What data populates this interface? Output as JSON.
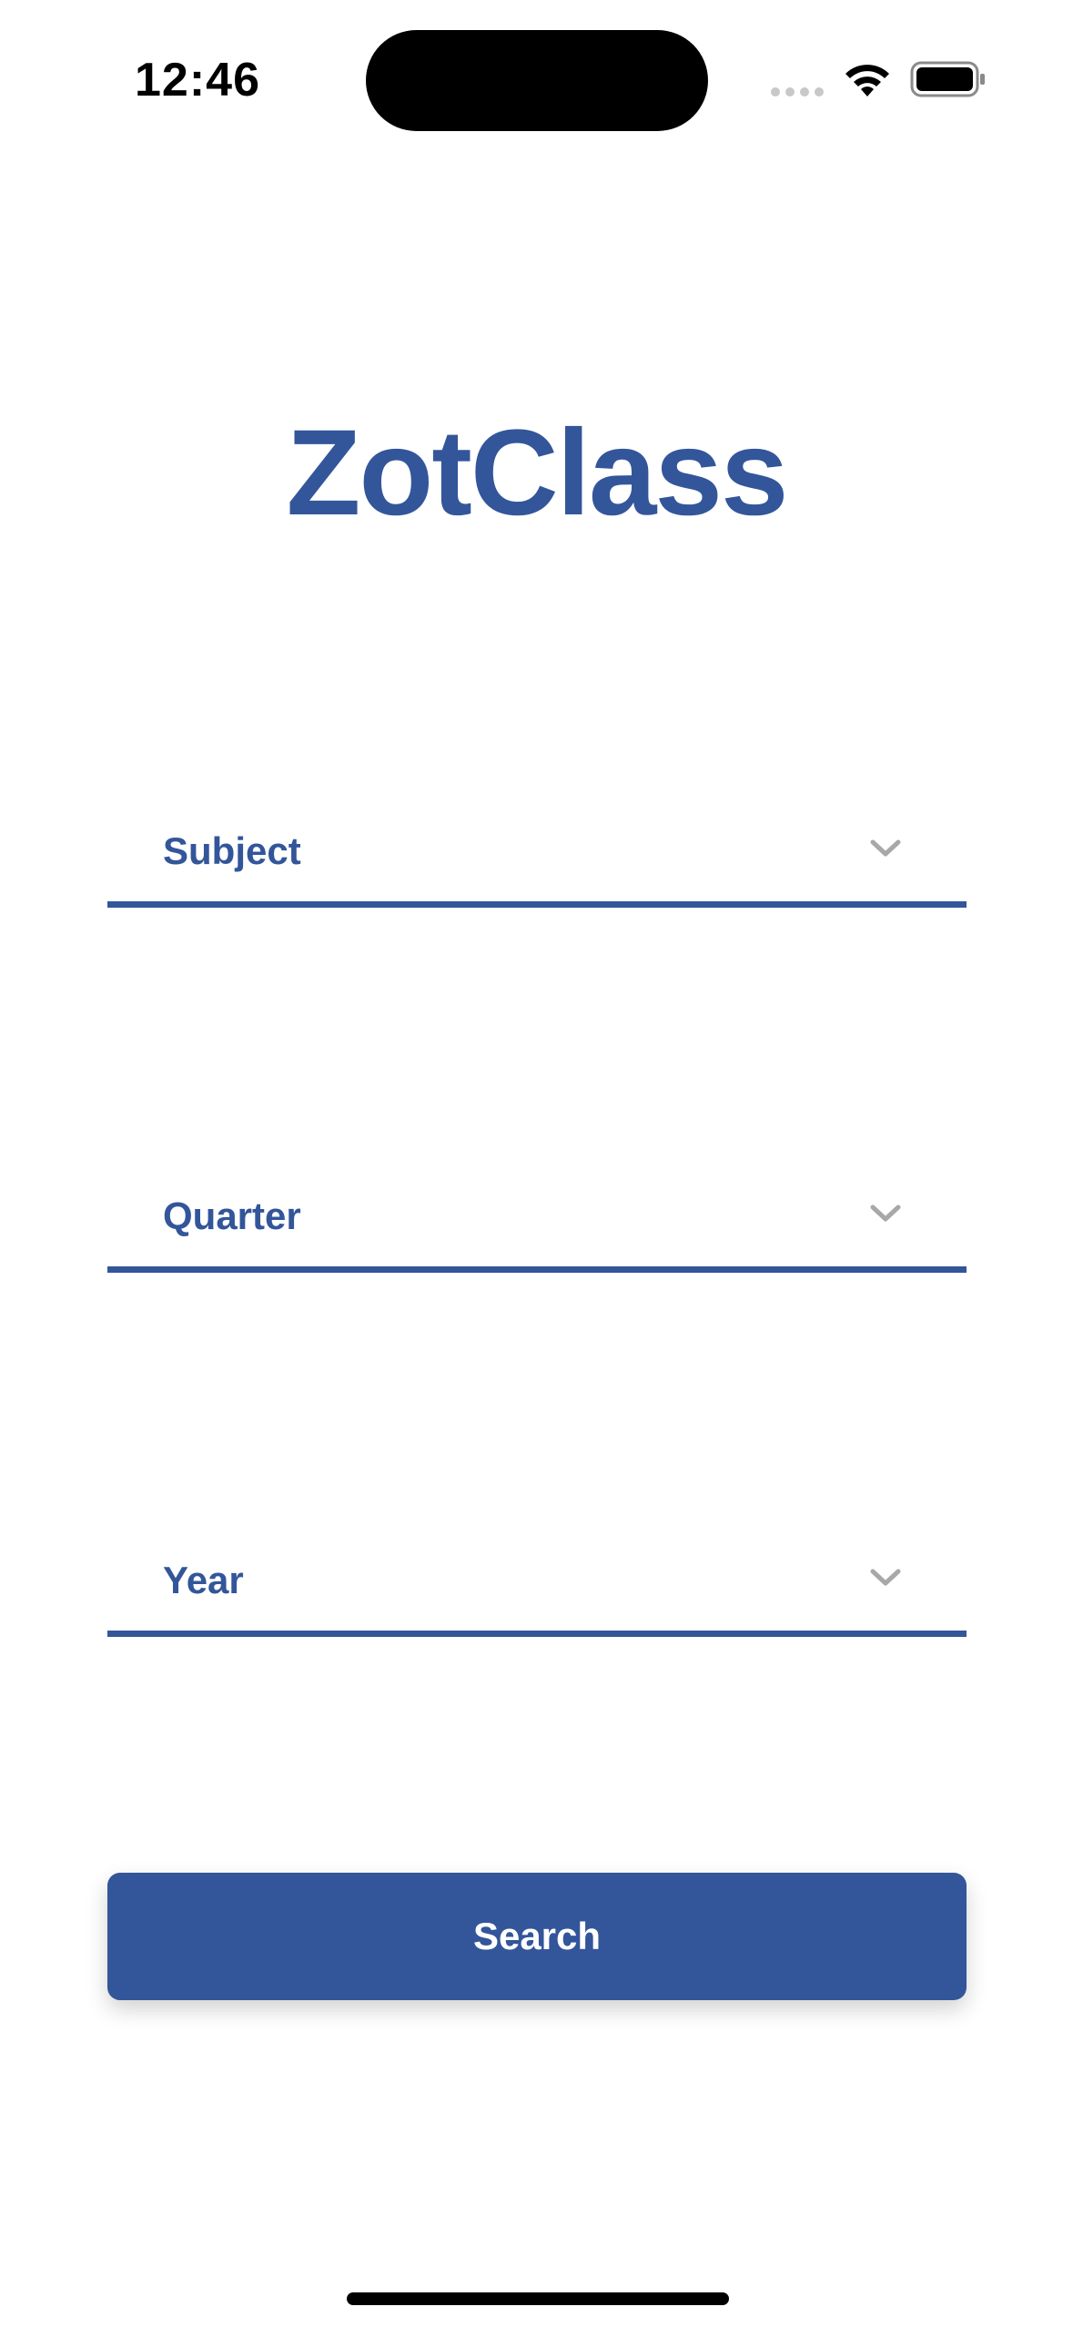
{
  "status_bar": {
    "time": "12:46"
  },
  "app": {
    "title": "ZotClass"
  },
  "form": {
    "fields": [
      {
        "label": "Subject",
        "icon": "chevron-down-icon"
      },
      {
        "label": "Quarter",
        "icon": "chevron-down-icon"
      },
      {
        "label": "Year",
        "icon": "chevron-down-icon"
      }
    ],
    "search_label": "Search"
  },
  "colors": {
    "brand": "#33569a",
    "chevron": "#a8a8a8",
    "background": "#ffffff"
  }
}
